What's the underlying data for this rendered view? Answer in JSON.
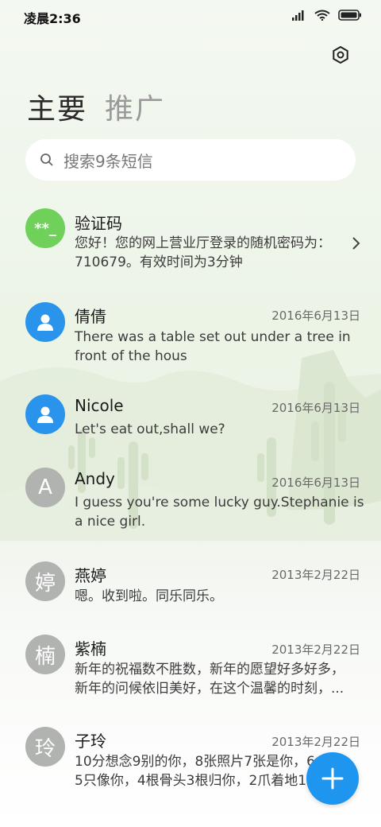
{
  "status_bar": {
    "time": "凌晨2:36"
  },
  "tabs": [
    {
      "label": "主要",
      "active": true
    },
    {
      "label": "推广",
      "active": false
    }
  ],
  "search": {
    "placeholder": "搜索9条短信"
  },
  "conversations": [
    {
      "name": "验证码",
      "avatar_text": "**_",
      "avatar_color": "#6fd05a",
      "date": "",
      "preview": [
        "您好！您的网上营业厅登录的随机密码为：",
        "710679。有效时间为3分钟"
      ]
    },
    {
      "name": "倩倩",
      "avatar_icon": "person-icon",
      "avatar_color": "#2a93ec",
      "date": "2016年6月13日",
      "preview": [
        "There was a table set out under a tree in",
        "front of the hous"
      ]
    },
    {
      "name": "Nicole",
      "avatar_icon": "person-icon",
      "avatar_color": "#2a93ec",
      "date": "2016年6月13日",
      "preview": [
        "Let's eat out,shall we?"
      ]
    },
    {
      "name": "Andy",
      "avatar_text": "A",
      "avatar_color": "#b1b3b1",
      "date": "2016年6月13日",
      "preview": [
        "I guess you're some lucky guy.Stephanie is",
        "a nice girl."
      ]
    },
    {
      "name": "燕婷",
      "avatar_text": "婷",
      "avatar_color": "#b1b3b1",
      "date": "2013年2月22日",
      "preview": [
        "嗯。收到啦。同乐同乐。"
      ]
    },
    {
      "name": "紫楠",
      "avatar_text": "楠",
      "avatar_color": "#b1b3b1",
      "date": "2013年2月22日",
      "preview": [
        "新年的祝福数不胜数，新年的愿望好多好多，",
        "新年的问候依旧美好，在这个温馨的时刻，..."
      ]
    },
    {
      "name": "子玲",
      "avatar_text": "玲",
      "avatar_color": "#b1b3b1",
      "date": "2013年2月22日",
      "preview": [
        "10分想念9别的你，8张照片7张是你，6",
        "5只像你，4根骨头3根归你，2爪着地1"
      ]
    }
  ],
  "fab": {
    "icon": "plus-icon",
    "color": "#1e95ee"
  }
}
